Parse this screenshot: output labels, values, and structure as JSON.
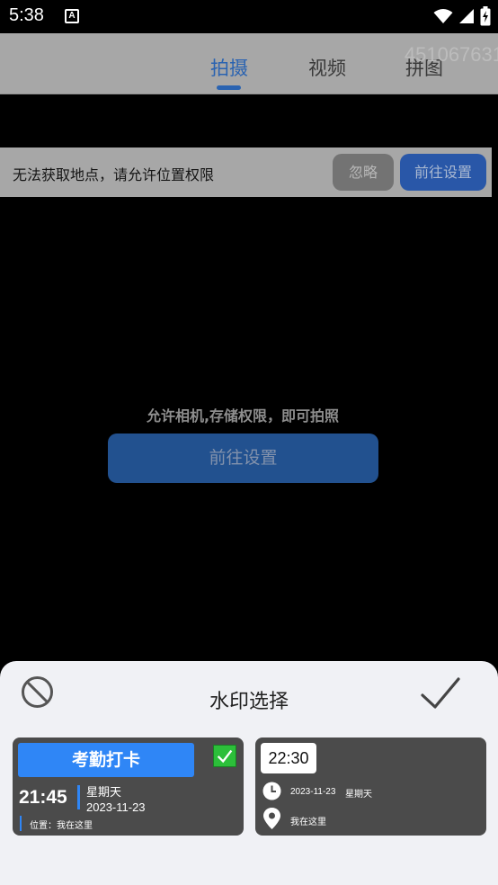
{
  "status_bar": {
    "time": "5:38",
    "notification_letter": "A"
  },
  "tabs": [
    {
      "label": "拍摄",
      "active": true
    },
    {
      "label": "视频",
      "active": false
    },
    {
      "label": "拼图",
      "active": false
    }
  ],
  "corner_id": "451067631",
  "location_banner": {
    "message": "无法获取地点，请允许位置权限",
    "ignore_label": "忽略",
    "settings_label": "前往设置"
  },
  "permission": {
    "message": "允许相机,存储权限，即可拍照",
    "button_label": "前往设置"
  },
  "sheet": {
    "title": "水印选择",
    "icons": {
      "cancel": "no-symbol-icon",
      "confirm": "checkmark-icon"
    }
  },
  "watermarks": [
    {
      "header": "考勤打卡",
      "selected": true,
      "time": "21:45",
      "weekday": "星期天",
      "date": "2023-11-23",
      "location": "位置：我在这里"
    },
    {
      "time": "22:30",
      "date": "2023-11-23",
      "weekday": "星期天",
      "location": "我在这里"
    }
  ],
  "colors": {
    "accent_blue": "#2a63b1",
    "header_gray": "#a7a7a7",
    "card_bg": "#4b4b4b",
    "check_green": "#2cbf3a"
  }
}
